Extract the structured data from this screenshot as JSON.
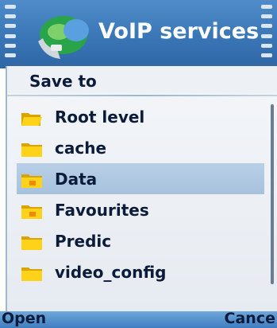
{
  "titlebar": {
    "title": "VoIP services"
  },
  "dialog": {
    "header": "Save to",
    "items": [
      {
        "label": "Root level",
        "icon": "folder-open-icon",
        "selected": false
      },
      {
        "label": "cache",
        "icon": "folder-icon",
        "selected": false
      },
      {
        "label": "Data",
        "icon": "folder-icon",
        "selected": true
      },
      {
        "label": "Favourites",
        "icon": "folder-icon",
        "selected": false
      },
      {
        "label": "Predic",
        "icon": "folder-icon",
        "selected": false
      },
      {
        "label": "video_config",
        "icon": "folder-icon",
        "selected": false
      }
    ]
  },
  "softkeys": {
    "left": "Open",
    "right": "Cance"
  },
  "colors": {
    "titlebar": "#3874b4",
    "selection": "#b0c9e2",
    "folder": "#f5c400",
    "text": "#0b1c3a"
  }
}
